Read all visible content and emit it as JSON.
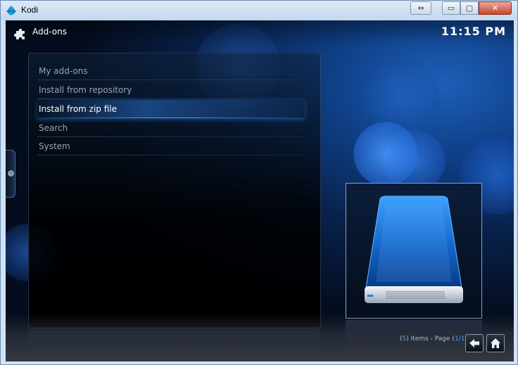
{
  "window": {
    "title": "Kodi",
    "snap_glyph": "⇔",
    "minimize_glyph": "▭",
    "maximize_glyph": "▢",
    "close_glyph": "✕"
  },
  "header": {
    "icon": "puzzle-piece-icon",
    "title": "Add-ons",
    "clock": "11:15 PM"
  },
  "menu": {
    "items": [
      {
        "label": "My add-ons",
        "selected": false
      },
      {
        "label": "Install from repository",
        "selected": false
      },
      {
        "label": "Install from zip file",
        "selected": true
      },
      {
        "label": "Search",
        "selected": false
      },
      {
        "label": "System",
        "selected": false
      }
    ]
  },
  "thumbnail": {
    "icon": "external-drive-icon"
  },
  "footer": {
    "count": "5",
    "items_label": "Items - Page",
    "page": "1/1",
    "back_icon": "arrow-left-icon",
    "home_icon": "home-icon"
  },
  "colors": {
    "accent": "#4aa3ff",
    "background": "#0f3f86",
    "menu_text": "#9aa4b3",
    "selected_text": "#ffffff"
  }
}
